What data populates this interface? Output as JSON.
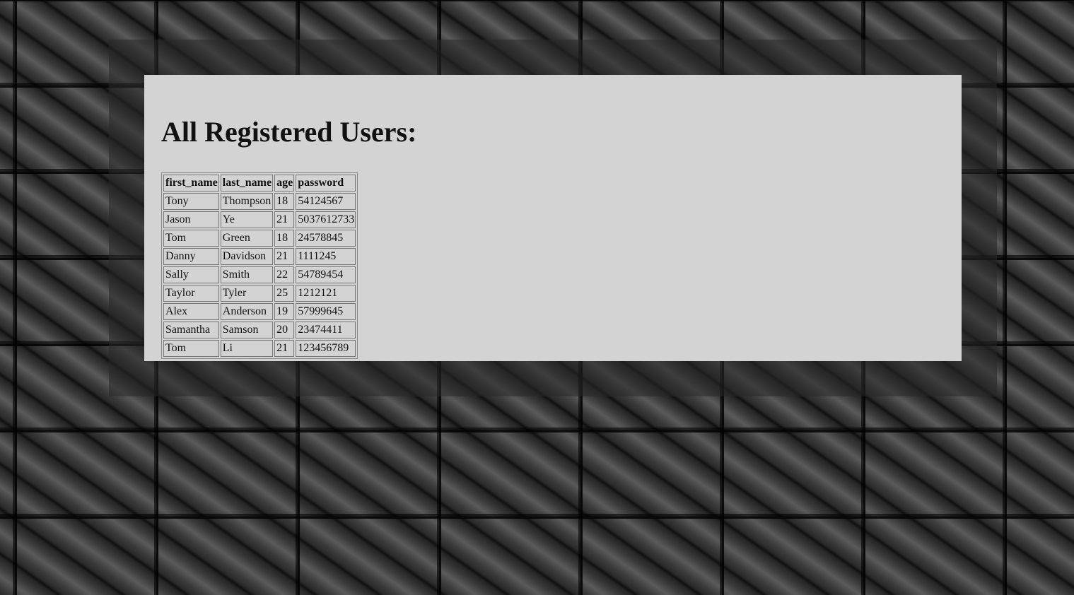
{
  "page": {
    "title": "All Registered Users:"
  },
  "table": {
    "headers": [
      "first_name",
      "last_name",
      "age",
      "password"
    ],
    "rows": [
      [
        "Tony",
        "Thompson",
        "18",
        "54124567"
      ],
      [
        "Jason",
        "Ye",
        "21",
        "5037612733"
      ],
      [
        "Tom",
        "Green",
        "18",
        "24578845"
      ],
      [
        "Danny",
        "Davidson",
        "21",
        "1111245"
      ],
      [
        "Sally",
        "Smith",
        "22",
        "54789454"
      ],
      [
        "Taylor",
        "Tyler",
        "25",
        "1212121"
      ],
      [
        "Alex",
        "Anderson",
        "19",
        "57999645"
      ],
      [
        "Samantha",
        "Samson",
        "20",
        "23474411"
      ],
      [
        "Tom",
        "Li",
        "21",
        "123456789"
      ]
    ]
  },
  "colors": {
    "panel_background": "#d3d3d3",
    "text": "#111111"
  }
}
